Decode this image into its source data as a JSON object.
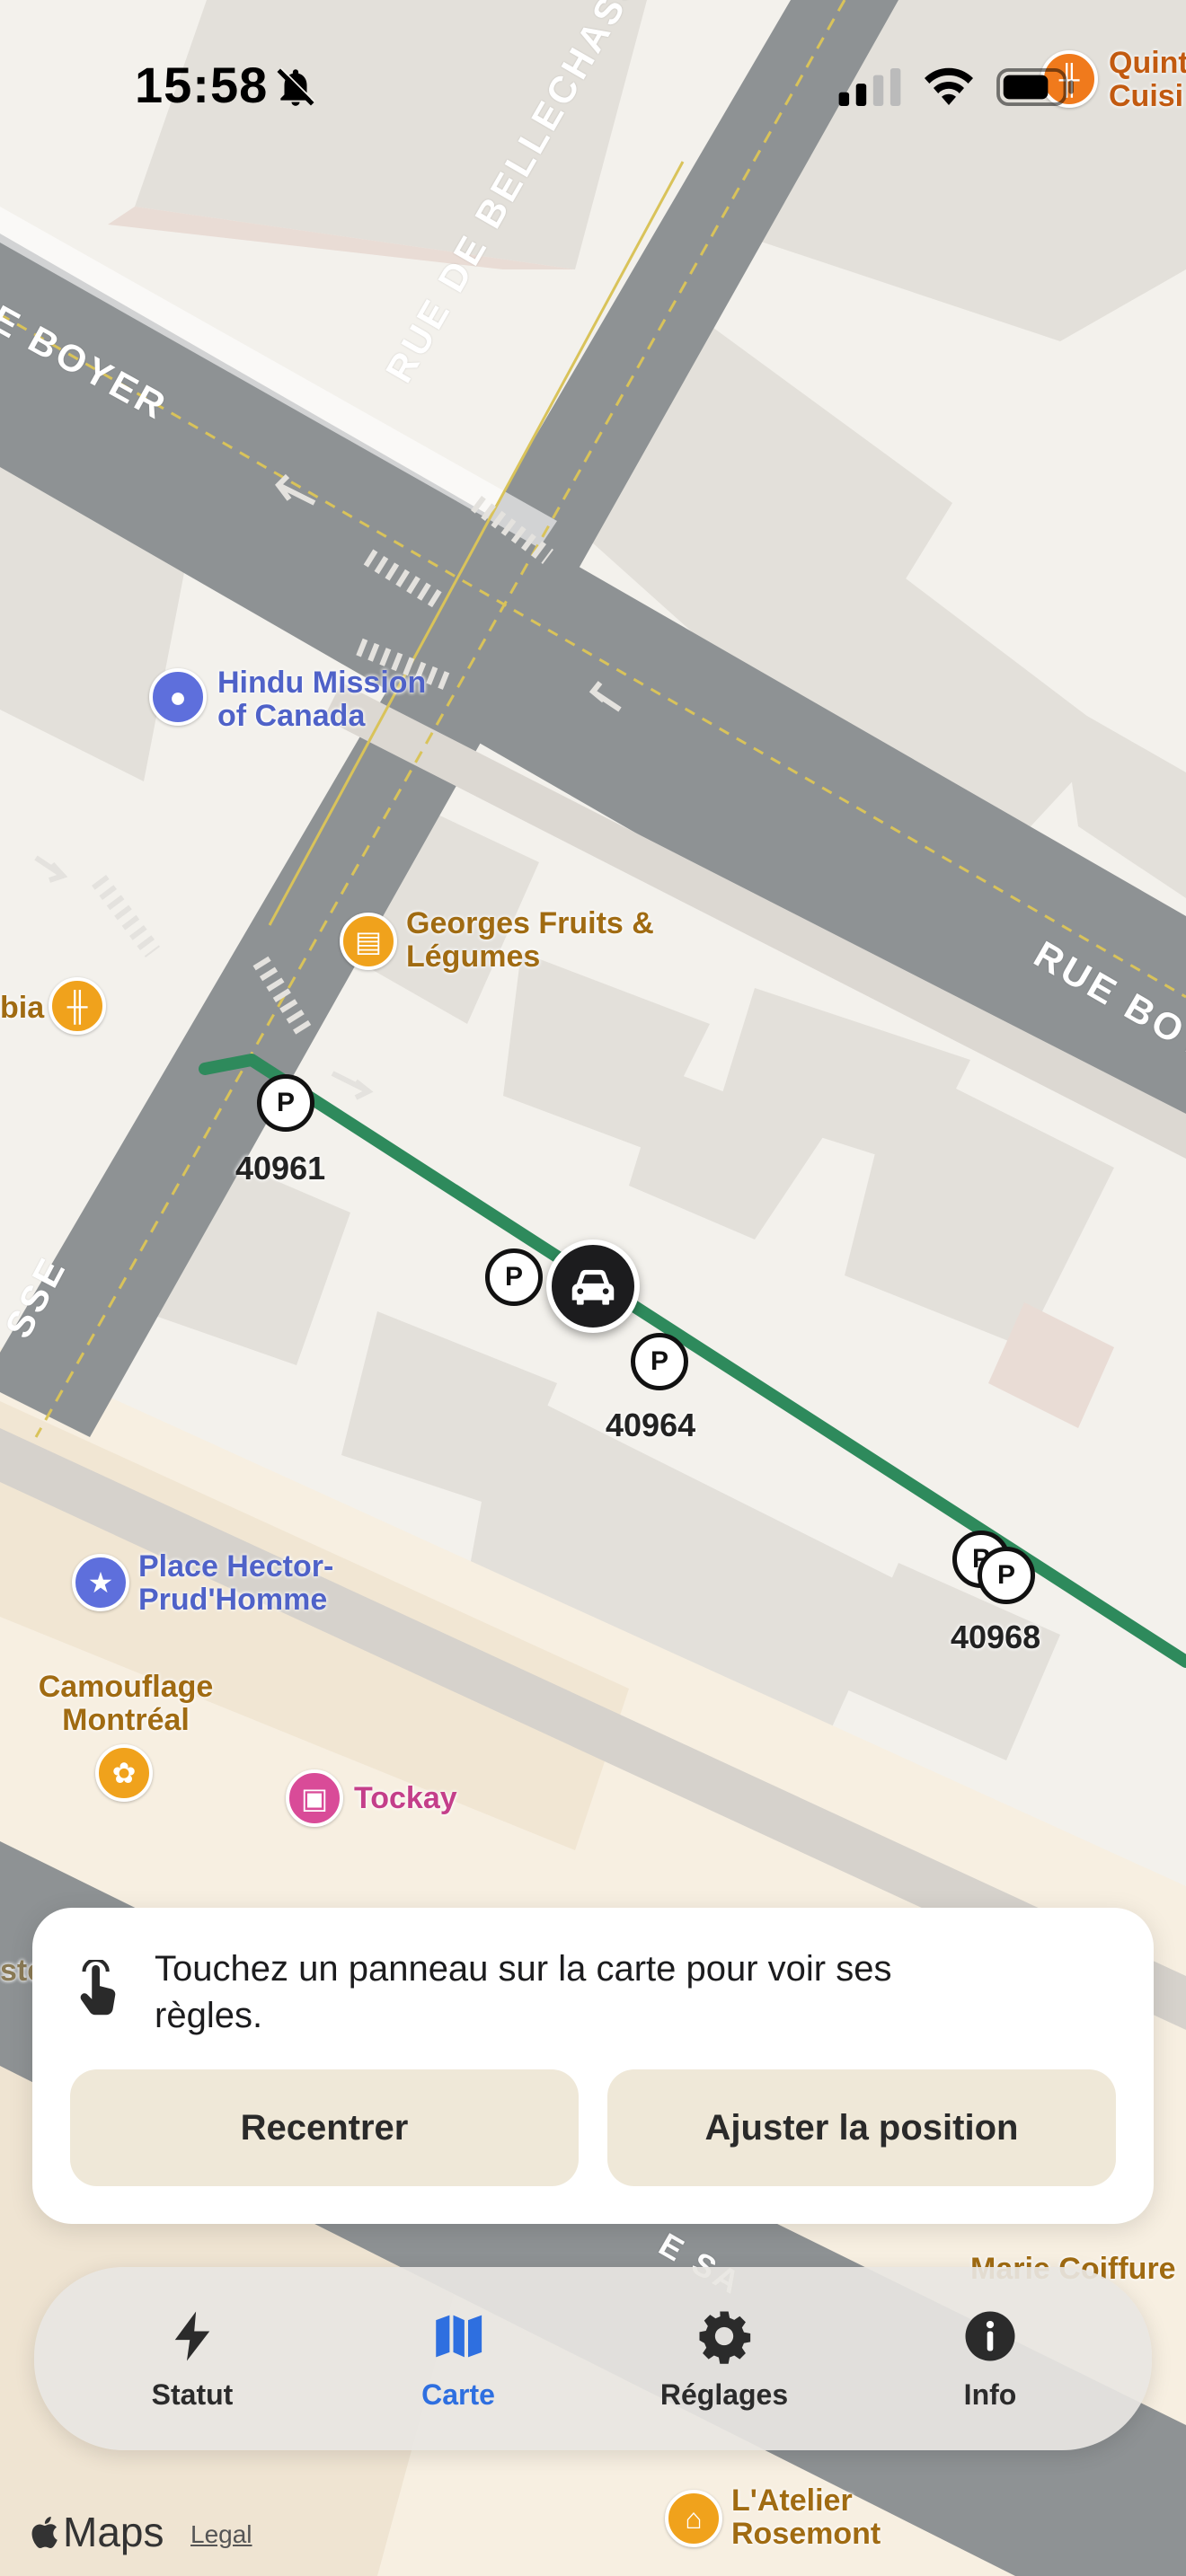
{
  "status_bar": {
    "time": "15:58"
  },
  "map": {
    "streets": {
      "boyer_nw": "E BOYER",
      "bellechasse": "RUE DE BELLECHASSE",
      "boyer_e": "RUE BOY",
      "sse": "SSE",
      "sa": "E SA"
    },
    "pois": {
      "hindu_mission": "Hindu Mission\nof Canada",
      "georges": "Georges Fruits &\nLégumes",
      "bia": "bia",
      "place_hector": "Place Hector-\nPrud'Homme",
      "camouflage": "Camouflage\nMontréal",
      "tockay": "Tockay",
      "quint": "Quint\nCuisi",
      "ste": "ste",
      "coiffure": "Marie Coiffure",
      "atelier": "L'Atelier\nRosemont"
    },
    "signs": {
      "s1": "40961",
      "s2": "40964",
      "s3": "40968"
    },
    "parking_glyph": "P"
  },
  "card": {
    "hint": "Touchez un panneau sur la carte pour voir ses règles.",
    "recenter_label": "Recentrer",
    "adjust_label": "Ajuster la position"
  },
  "tabs": [
    {
      "label": "Statut",
      "icon": "bolt-icon"
    },
    {
      "label": "Carte",
      "icon": "map-icon"
    },
    {
      "label": "Réglages",
      "icon": "gear-icon"
    },
    {
      "label": "Info",
      "icon": "info-icon"
    }
  ],
  "footer": {
    "maps_label": "Maps",
    "legal_label": "Legal"
  },
  "colors": {
    "accent": "#2e6fe0",
    "route": "#2e8a5c",
    "road": "#8e9294",
    "button_bg": "#efe8d8"
  }
}
